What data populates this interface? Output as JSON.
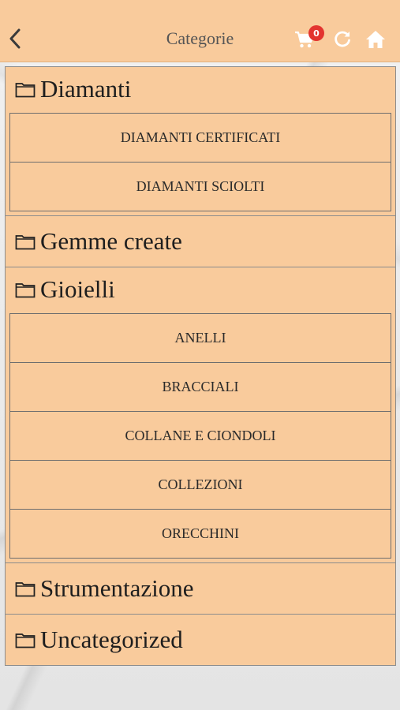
{
  "header": {
    "title": "Categorie",
    "cart_count": "0",
    "back_icon": "chevron-left-icon",
    "cart_icon": "cart-icon",
    "refresh_icon": "refresh-icon",
    "home_icon": "home-icon",
    "bg_color": "#f9cb9c"
  },
  "categories": [
    {
      "label": "Diamanti",
      "children": [
        "DIAMANTI CERTIFICATI",
        "DIAMANTI SCIOLTI"
      ]
    },
    {
      "label": "Gemme create",
      "children": []
    },
    {
      "label": "Gioielli",
      "children": [
        "ANELLI",
        "BRACCIALI",
        "COLLANE E CIONDOLI",
        "COLLEZIONI",
        "ORECCHINI"
      ]
    },
    {
      "label": "Strumentazione",
      "children": []
    },
    {
      "label": "Uncategorized",
      "children": []
    }
  ],
  "colors": {
    "panel": "#f9cb9c",
    "badge": "#e3342f",
    "border": "#8c8c8c"
  }
}
